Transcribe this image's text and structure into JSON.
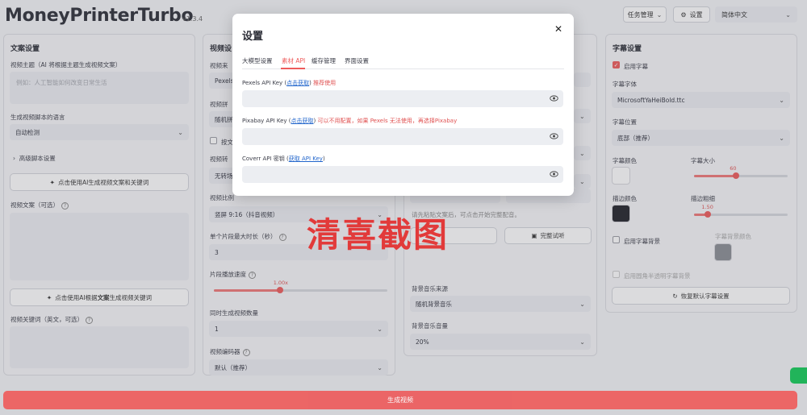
{
  "app": {
    "title": "MoneyPrinterTurbo",
    "version": "v1.3.4"
  },
  "header": {
    "task_button": "任务管理",
    "settings_button": "设置",
    "language": "简体中文"
  },
  "left_panel": {
    "title": "文案设置",
    "topic_label": "视频主题（AI 将根据主题生成视频文案）",
    "topic_placeholder": "例如：人工智能如何改变日常生活",
    "lang_label": "生成视频脚本的语言",
    "lang_value": "自动检测",
    "advanced": "高级脚本设置",
    "gen_script_btn": "点击使用AI生成视频文案和关键词",
    "script_label": "视频文案（可选）",
    "gen_keywords_btn_pre": "点击使用AI根据",
    "gen_keywords_btn_bold": "文案",
    "gen_keywords_btn_post": "生成视频关键词",
    "keywords_label": "视频关键词（英文，可选）"
  },
  "mid_panel": {
    "title": "视频设",
    "source_label": "视频来",
    "source_value": "Pexels",
    "concat_label": "视频拼",
    "concat_value": "随机拼",
    "cb_label": "按文",
    "transition_label": "视频转",
    "transition_value": "无转场",
    "ratio_label": "视频比例",
    "ratio_value": "竖屏 9:16（抖音视频）",
    "clip_label": "单个片段最大时长（秒）",
    "clip_value": "3",
    "speed_label": "片段播放速度",
    "speed_value": "1.00x",
    "speed_fraction": 0.38,
    "count_label": "同时生成视频数量",
    "count_value": "1",
    "codec_label": "视频编码器",
    "codec_value": "默认（推荐）"
  },
  "audio_panel": {
    "hint": "请先粘贴文案后，可点击开始完整配音。",
    "trial_button": "完整试听",
    "bgm_label": "背景音乐来源",
    "bgm_value": "随机背景音乐",
    "bgm_vol_label": "背景音乐音量",
    "bgm_vol_value": "20%"
  },
  "right_panel": {
    "title": "字幕设置",
    "enable_subtitle": "启用字幕",
    "font_label": "字幕字体",
    "font_value": "MicrosoftYaHeiBold.ttc",
    "pos_label": "字幕位置",
    "pos_value": "底部（推荐）",
    "color_label": "字幕颜色",
    "size_label": "字幕大小",
    "size_value": "60",
    "size_fraction": 0.45,
    "stroke_color_label": "描边颜色",
    "stroke_width_label": "描边粗细",
    "stroke_width_value": "1.50",
    "stroke_fraction": 0.15,
    "bg_enable": "启用字幕背景",
    "bg_color_label": "字幕背景颜色",
    "rounded_label": "启用圆角半透明字幕背景",
    "reset_button": "恢复默认字幕设置",
    "colors": {
      "subtitle": "#ffffff",
      "stroke": "#1f2128",
      "background": "#8a8d94"
    }
  },
  "generate_button": "生成视频",
  "modal": {
    "title": "设置",
    "tabs": [
      "大模型设置",
      "素材 API",
      "缓存管理",
      "界面设置"
    ],
    "pexels_label": "Pexels API Key (",
    "pexels_link": "点击获取",
    "pexels_tail": ") ",
    "pexels_recommend": "推荐使用",
    "pixabay_label": "Pixabay API Key (",
    "pixabay_link": "点击获取",
    "pixabay_tail": ") ",
    "pixabay_note": "可以不用配置，如果 Pexels 无法使用，再选择Pixabay",
    "coverr_label": "Coverr API 密钥 (",
    "coverr_link": "获取 API Key",
    "coverr_tail": ")"
  },
  "watermark": "清喜截图",
  "accent_color": "#ee5a5a"
}
